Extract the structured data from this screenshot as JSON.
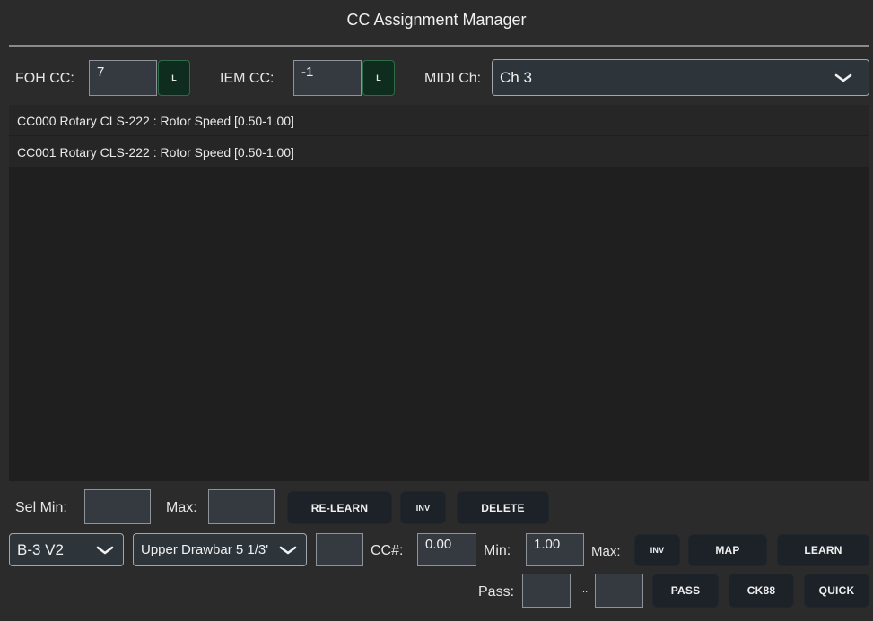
{
  "window": {
    "title": "CC Assignment Manager"
  },
  "header": {
    "foh_label": "FOH CC:",
    "foh_value": "7",
    "foh_learn": "L",
    "iem_label": "IEM CC:",
    "iem_value": "-1",
    "iem_learn": "L",
    "midi_label": "MIDI Ch:",
    "midi_value": "Ch 3"
  },
  "assignments": [
    {
      "text": "CC000  Rotary CLS-222 : Rotor Speed  [0.50-1.00]"
    },
    {
      "text": "CC001  Rotary CLS-222 : Rotor Speed  [0.50-1.00]"
    }
  ],
  "selection": {
    "min_label": "Sel Min:",
    "min_value": "",
    "max_label": "Max:",
    "max_value": "",
    "relearn": "RE-LEARN",
    "inv": "INV",
    "delete": "DELETE"
  },
  "assign": {
    "instrument": "B-3 V2",
    "parameter": "Upper Drawbar 5 1/3'",
    "cc_value": "",
    "cc_label": "CC#:",
    "range_start": "0.00",
    "min_label": "Min:",
    "min_value": "1.00",
    "max_label": "Max:",
    "inv": "INV",
    "map": "MAP",
    "learn": "LEARN"
  },
  "pass": {
    "label": "Pass:",
    "from_value": "",
    "separator": "...",
    "to_value": "",
    "pass_btn": "PASS",
    "ck88_btn": "CK88",
    "quick_btn": "QUICK"
  }
}
